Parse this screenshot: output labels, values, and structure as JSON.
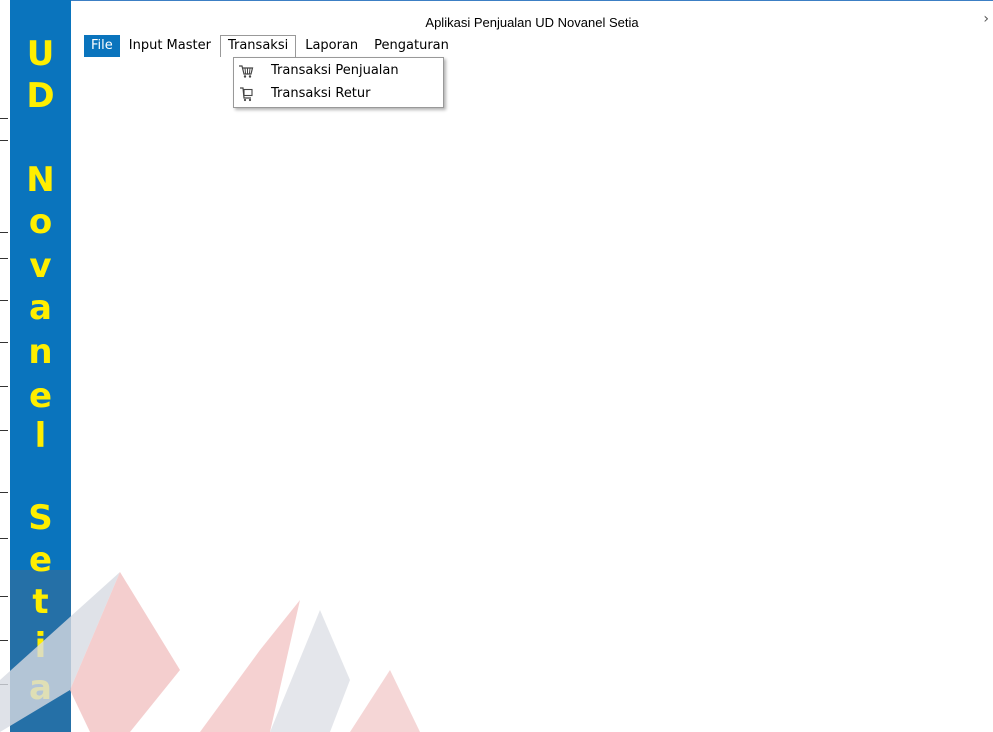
{
  "window": {
    "title": "Aplikasi Penjualan UD Novanel Setia",
    "close_glyph": "›"
  },
  "sidebar": {
    "letters": [
      "U",
      "D",
      "N",
      "o",
      "v",
      "a",
      "n",
      "e",
      "l",
      "S",
      "e",
      "t",
      "i",
      "a"
    ]
  },
  "menu": {
    "items": [
      "File",
      "Input Master",
      "Transaksi",
      "Laporan",
      "Pengaturan"
    ]
  },
  "dropdown": {
    "items": [
      {
        "label": "Transaksi Penjualan",
        "icon": "cart-icon"
      },
      {
        "label": "Transaksi Retur",
        "icon": "return-cart-icon"
      }
    ]
  },
  "colors": {
    "sidebar_bg": "#0a74bd",
    "sidebar_text": "#ffee00",
    "watermark": "#f3c7c7"
  }
}
